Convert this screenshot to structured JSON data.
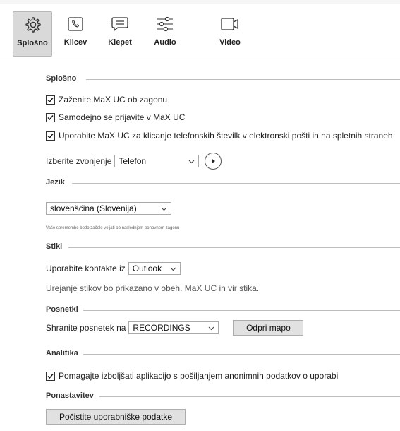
{
  "tabs": [
    {
      "id": "splosno",
      "label": "Splošno",
      "icon": "gear-icon",
      "active": true
    },
    {
      "id": "klicev",
      "label": "Klicev",
      "icon": "phone-icon",
      "active": false
    },
    {
      "id": "klepet",
      "label": "Klepet",
      "icon": "chat-icon",
      "active": false
    },
    {
      "id": "audio",
      "label": "Audio",
      "icon": "sliders-icon",
      "active": false
    },
    {
      "id": "video",
      "label": "Video",
      "icon": "video-camera-icon",
      "active": false
    }
  ],
  "general": {
    "title": "Splošno",
    "startup": "Zaženite MaX UC ob zagonu",
    "autologin": "Samodejno se prijavite v MaX UC",
    "click_to_call": "Uporabite MaX UC za klicanje telefonskih številk v elektronski pošti in na spletnih straneh",
    "ringtone_label": "Izberite zvonjenje",
    "ringtone_value": "Telefon"
  },
  "language": {
    "title": "Jezik",
    "value": "slovenščina (Slovenija)",
    "note": "Vaše spremembe bodo začele veljati ob naslednjem ponovnem zagonu"
  },
  "contacts": {
    "title": "Stiki",
    "source_label": "Uporabite kontakte iz",
    "source_value": "Outlook",
    "info": "Urejanje stikov bo prikazano v obeh. MaX UC in vir stika."
  },
  "recordings": {
    "title": "Posnetki",
    "save_label": "Shranite posnetek na",
    "save_value": "RECORDINGS",
    "open_folder": "Odpri mapo"
  },
  "analytics": {
    "title": "Analitika",
    "help_improve": "Pomagajte izboljšati aplikacijo s pošiljanjem anonimnih podatkov o uporabi"
  },
  "reset": {
    "title": "Ponastavitev",
    "clear_button": "Počistite uporabniške podatke"
  }
}
